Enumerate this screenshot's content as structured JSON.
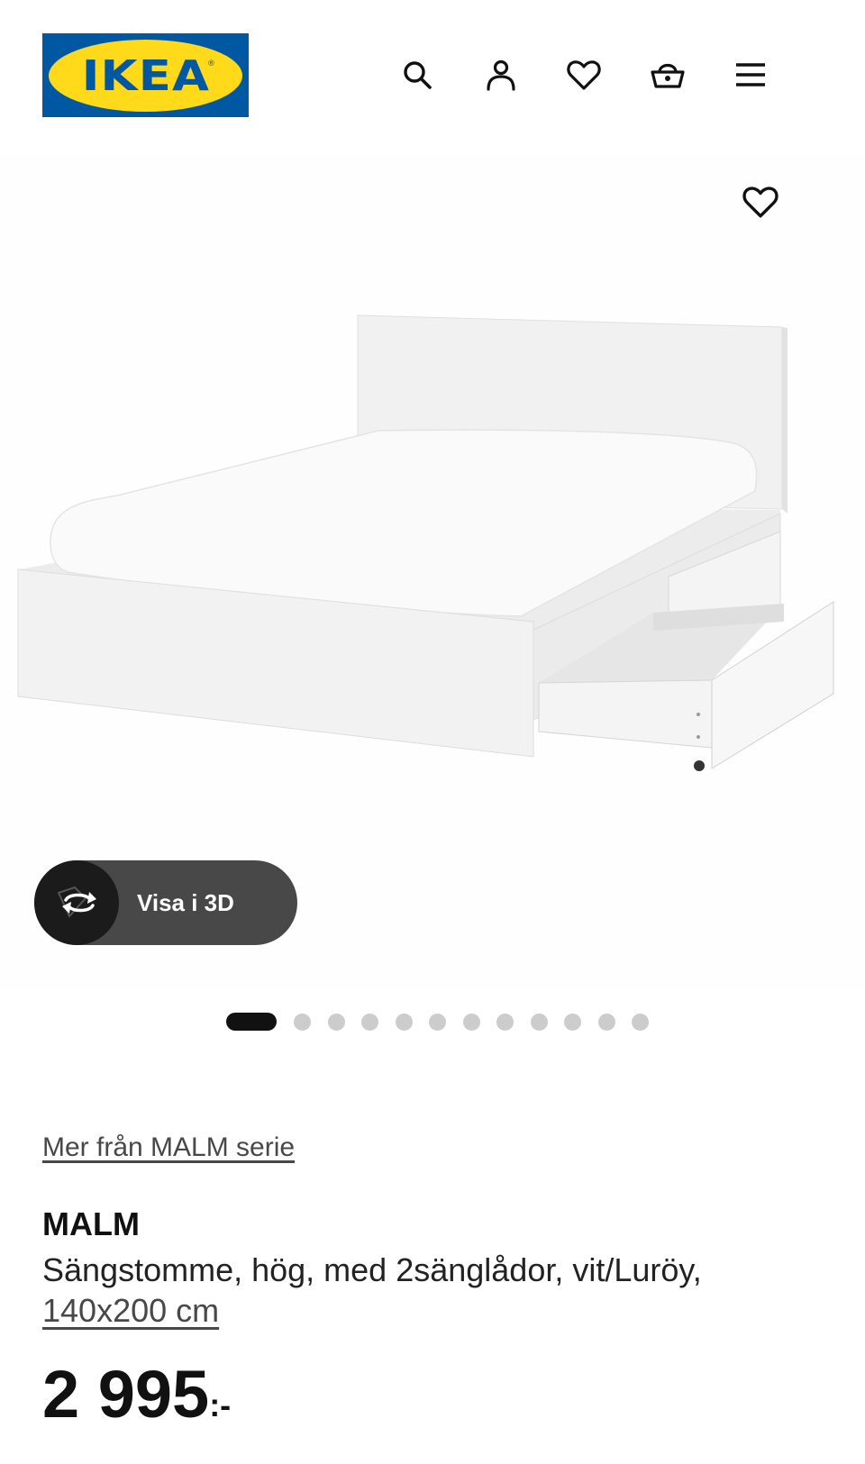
{
  "brand": {
    "logo_text": "IKEA",
    "colors": {
      "blue": "#0058a3",
      "yellow": "#ffda1a"
    }
  },
  "header": {
    "icons": [
      "search-icon",
      "user-icon",
      "heart-icon",
      "basket-icon",
      "menu-icon"
    ]
  },
  "gallery": {
    "view_3d_label": "Visa i 3D",
    "image_count": 12,
    "active_index": 0
  },
  "product": {
    "series_link": "Mer från MALM serie",
    "name": "MALM",
    "description": "Sängstomme, hög, med 2sänglådor, vit/Luröy,",
    "size": "140x200 cm",
    "price_integer": "2 995",
    "price_suffix": ":-"
  }
}
